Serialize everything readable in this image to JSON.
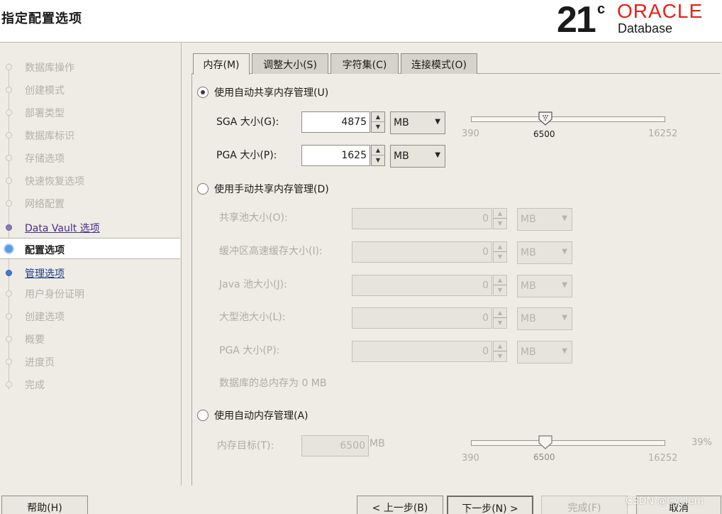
{
  "header": {
    "title": "指定配置选项",
    "logo_number": "21",
    "logo_suffix": "c",
    "logo_brand": "ORACLE",
    "logo_product": "Database"
  },
  "sidebar": {
    "steps": [
      {
        "label": "数据库操作",
        "state": "disabled"
      },
      {
        "label": "创建模式",
        "state": "disabled"
      },
      {
        "label": "部署类型",
        "state": "disabled"
      },
      {
        "label": "数据库标识",
        "state": "disabled"
      },
      {
        "label": "存储选项",
        "state": "disabled"
      },
      {
        "label": "快速恢复选项",
        "state": "disabled"
      },
      {
        "label": "网络配置",
        "state": "disabled"
      },
      {
        "label": "Data Vault 选项",
        "state": "link"
      },
      {
        "label": "配置选项",
        "state": "current"
      },
      {
        "label": "管理选项",
        "state": "next"
      },
      {
        "label": "用户身份证明",
        "state": "disabled"
      },
      {
        "label": "创建选项",
        "state": "disabled"
      },
      {
        "label": "概要",
        "state": "disabled"
      },
      {
        "label": "进度页",
        "state": "disabled"
      },
      {
        "label": "完成",
        "state": "disabled"
      }
    ]
  },
  "tabs": [
    "内存(M)",
    "调整大小(S)",
    "字符集(C)",
    "连接模式(O)"
  ],
  "active_tab": "内存(M)",
  "memory": {
    "asmm": {
      "label": "使用自动共享内存管理(U)",
      "selected": true,
      "sga": {
        "label": "SGA 大小(G):",
        "value": "4875",
        "unit": "MB"
      },
      "pga": {
        "label": "PGA 大小(P):",
        "value": "1625",
        "unit": "MB"
      },
      "slider": {
        "min": "390",
        "current": "6500",
        "max": "16252"
      }
    },
    "manual": {
      "label": "使用手动共享内存管理(D)",
      "selected": false,
      "fields": [
        {
          "label": "共享池大小(O):",
          "value": "0",
          "unit": "MB"
        },
        {
          "label": "缓冲区高速缓存大小(I):",
          "value": "0",
          "unit": "MB"
        },
        {
          "label": "Java 池大小(J):",
          "value": "0",
          "unit": "MB"
        },
        {
          "label": "大型池大小(L):",
          "value": "0",
          "unit": "MB"
        },
        {
          "label": "PGA 大小(P):",
          "value": "0",
          "unit": "MB"
        }
      ],
      "total_note": "数据库的总内存为 0 MB"
    },
    "amm": {
      "label": "使用自动内存管理(A)",
      "selected": false,
      "target": {
        "label": "内存目标(T):",
        "value": "6500",
        "unit": "MB"
      },
      "slider": {
        "min": "390",
        "current": "6500",
        "max": "16252",
        "percent": "39%"
      }
    }
  },
  "footer": {
    "help": "帮助(H)",
    "back": "< 上一步(B)",
    "next": "下一步(N) >",
    "finish": "完成(F)",
    "cancel": "取消"
  },
  "watermark": "CSDN @Cyclem"
}
